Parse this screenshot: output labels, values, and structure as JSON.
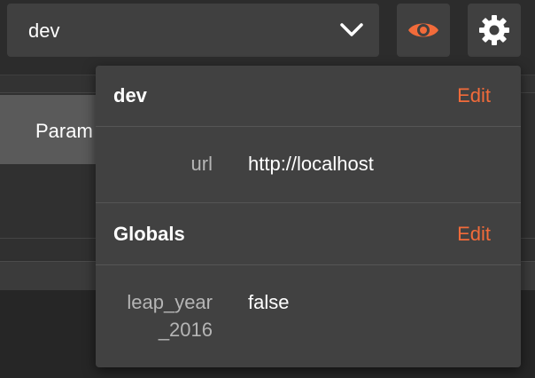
{
  "toolbar": {
    "environment_selected": "dev",
    "eye_icon": "eye-icon",
    "settings_icon": "gear-icon",
    "accent_color": "#f26b3a"
  },
  "background": {
    "params_tab_label": "Param"
  },
  "popup": {
    "environment": {
      "title": "dev",
      "edit_label": "Edit",
      "variables": [
        {
          "key": "url",
          "value": "http://localhost"
        }
      ]
    },
    "globals": {
      "title": "Globals",
      "edit_label": "Edit",
      "variables": [
        {
          "key_line1": "leap_year",
          "key_line2": "_2016",
          "value": "false"
        }
      ]
    }
  }
}
